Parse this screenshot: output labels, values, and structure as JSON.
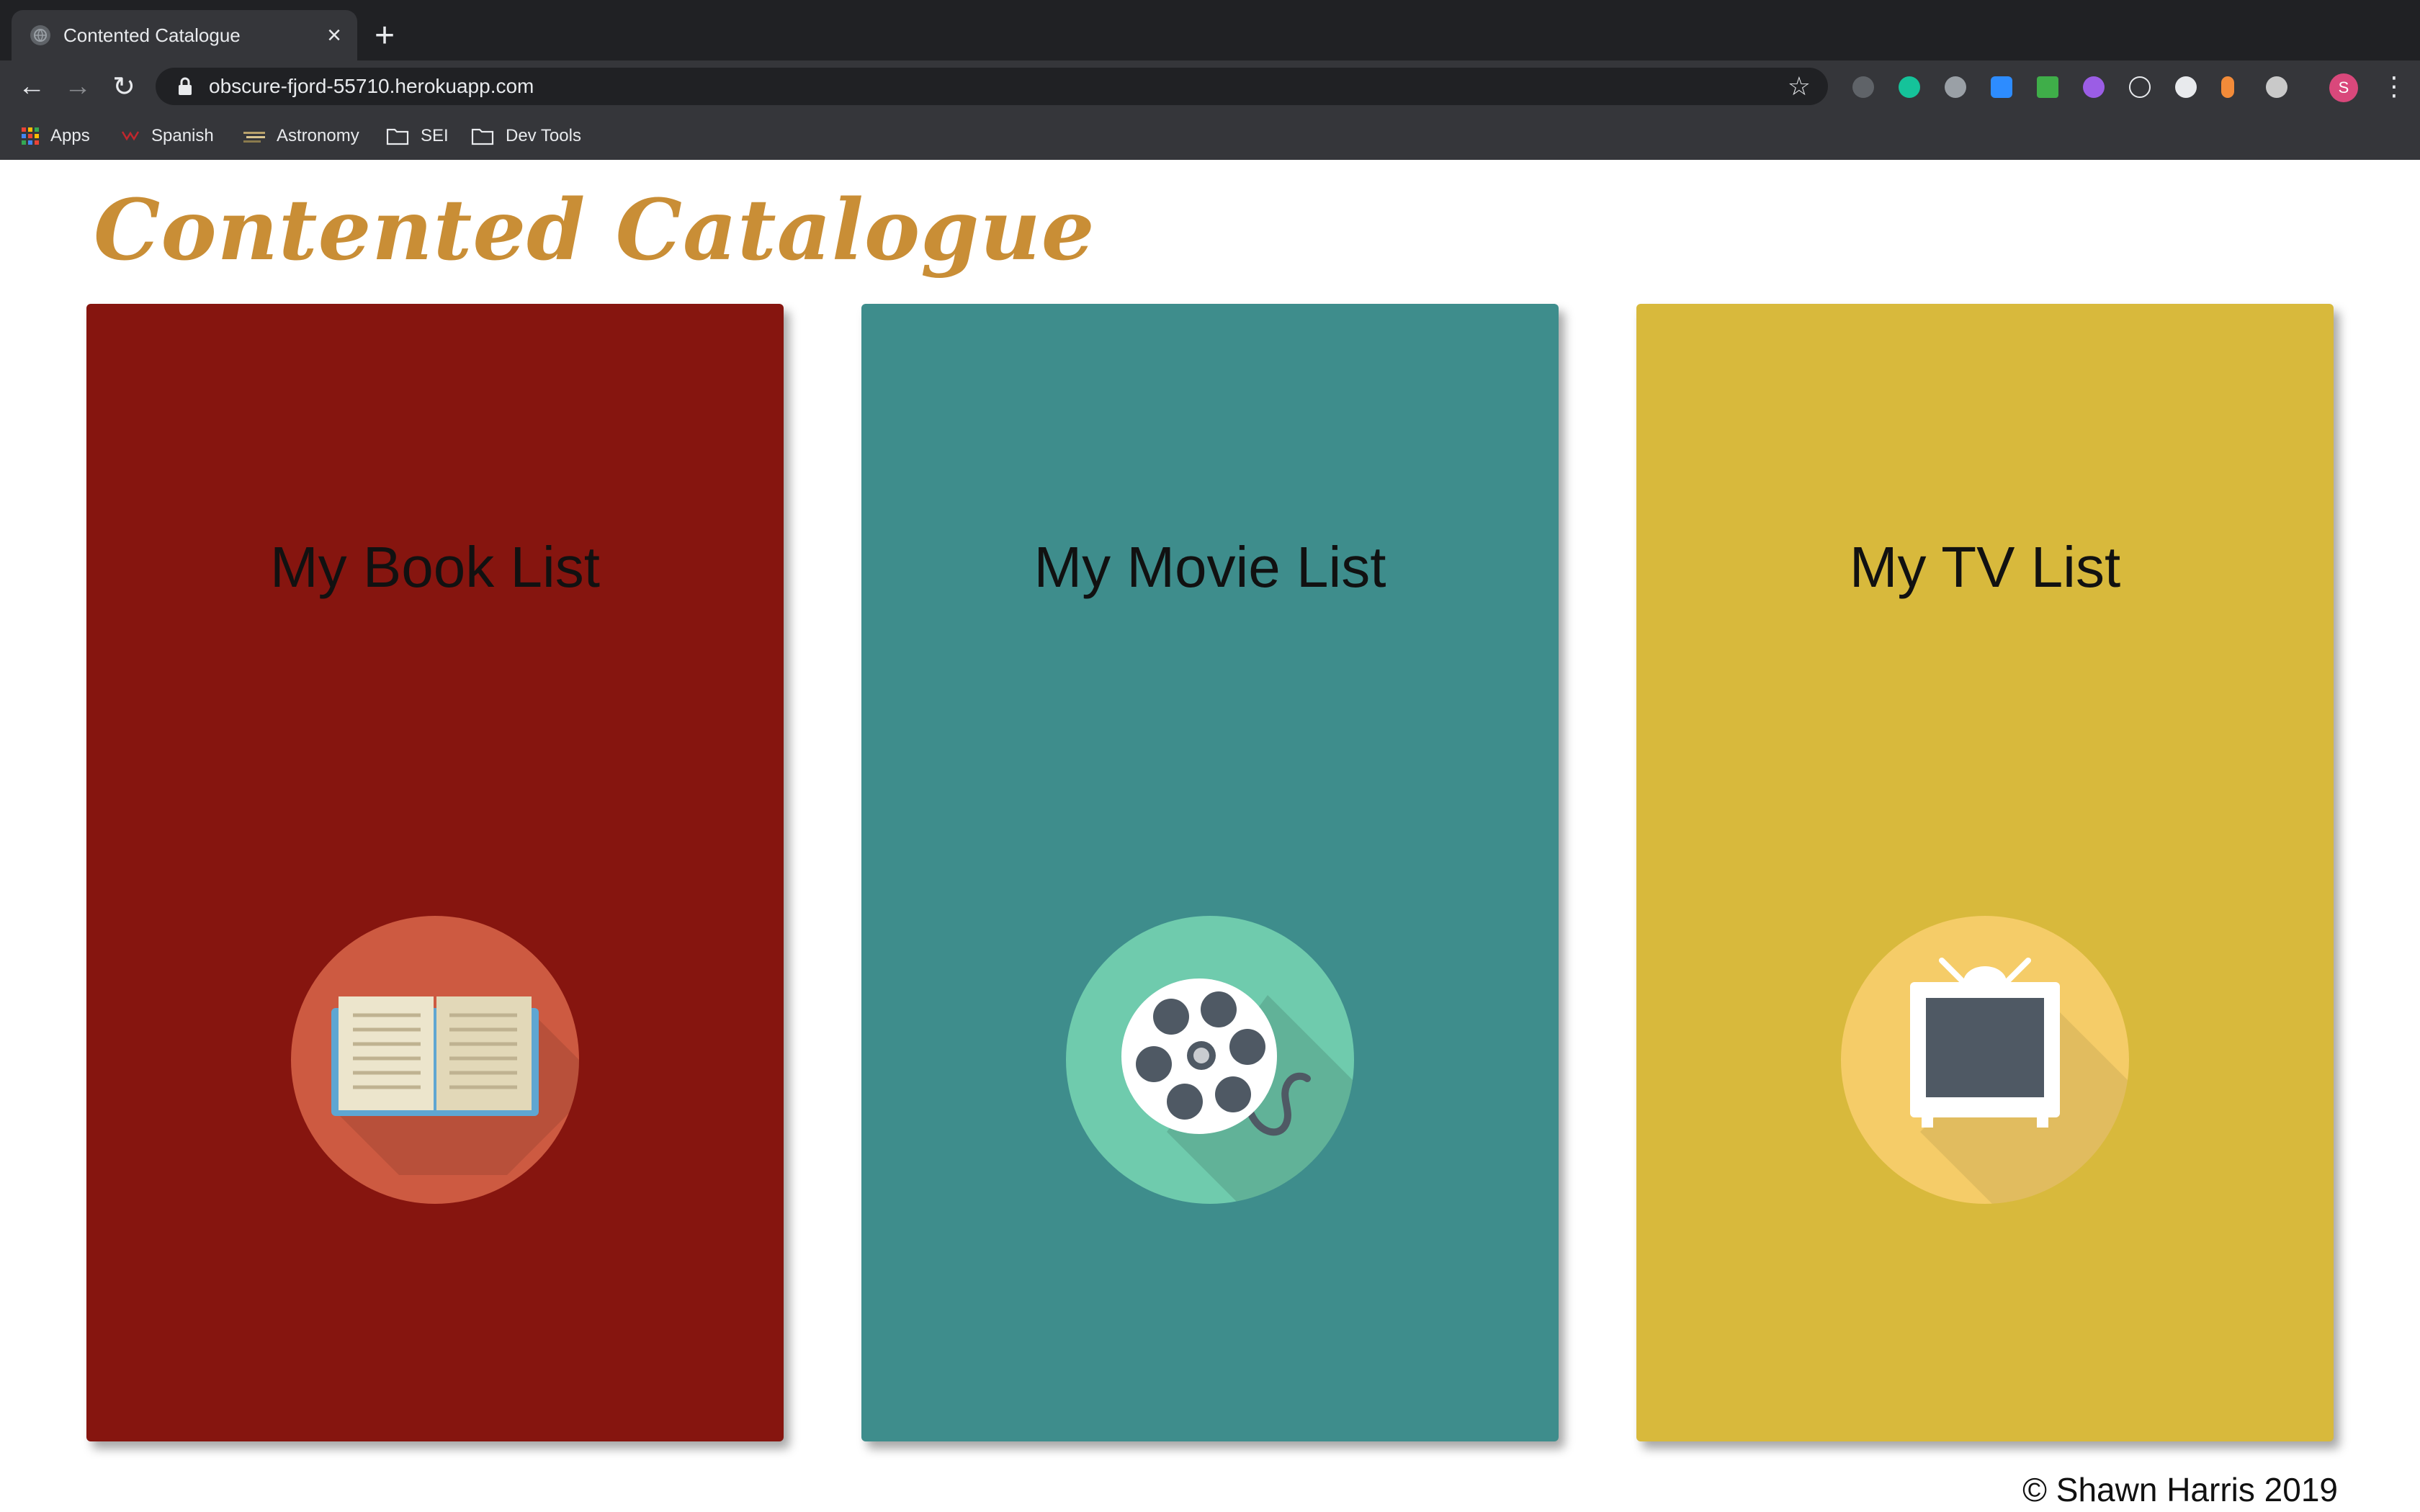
{
  "browser": {
    "tab": {
      "title": "Contented Catalogue",
      "close_glyph": "×"
    },
    "new_tab_glyph": "+",
    "nav": {
      "back_glyph": "←",
      "forward_glyph": "→",
      "reload_glyph": "↻"
    },
    "url": "obscure-fjord-55710.herokuapp.com",
    "star_glyph": "☆",
    "profile_initial": "S",
    "bookmarks": [
      {
        "label": "Apps",
        "icon": "apps-grid-icon"
      },
      {
        "label": "Spanish",
        "icon": "bookmark-favicon"
      },
      {
        "label": "Astronomy",
        "icon": "bookmark-favicon"
      },
      {
        "label": "SEI",
        "icon": "folder-icon"
      },
      {
        "label": "Dev Tools",
        "icon": "folder-icon"
      }
    ]
  },
  "page": {
    "site_title": "Contented Catalogue",
    "cards": [
      {
        "title": "My Book List",
        "icon": "book-icon",
        "bg": "#86150f",
        "circle": "#cd5a41"
      },
      {
        "title": "My Movie List",
        "icon": "film-reel-icon",
        "bg": "#3e8d8c",
        "circle": "#6fcbad"
      },
      {
        "title": "My TV List",
        "icon": "television-icon",
        "bg": "#d8b93c",
        "circle": "#f5cc68"
      }
    ],
    "footer": "© Shawn Harris 2019"
  }
}
